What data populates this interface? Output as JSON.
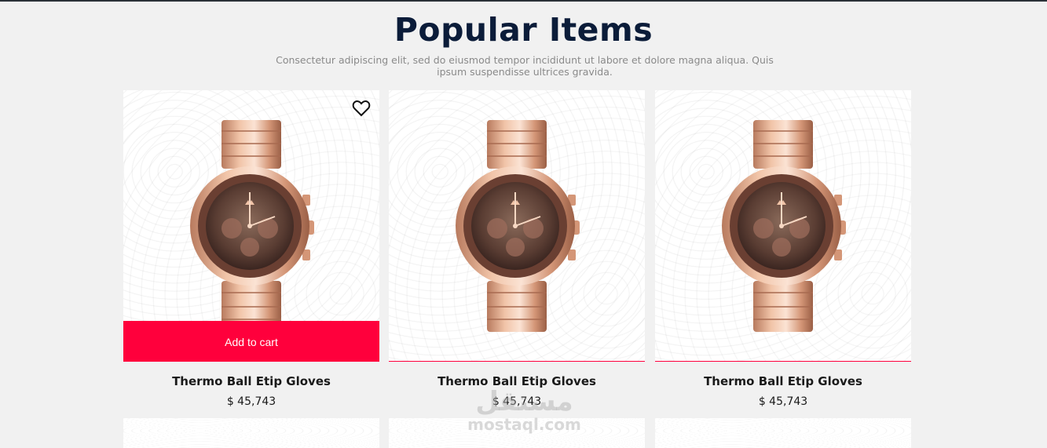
{
  "section": {
    "title": "Popular Items",
    "subtitle": "Consectetur adipiscing elit, sed do eiusmod tempor incididunt ut labore et dolore magna aliqua. Quis ipsum suspendisse ultrices gravida."
  },
  "products": [
    {
      "name": "Thermo Ball Etip Gloves",
      "price": "$ 45,743",
      "cta": "Add to cart",
      "icon": "heart-outline-icon"
    },
    {
      "name": "Thermo Ball Etip Gloves",
      "price": "$ 45,743"
    },
    {
      "name": "Thermo Ball Etip Gloves",
      "price": "$ 45,743"
    }
  ],
  "watermark": {
    "arabic": "مستقل",
    "latin": "mostaql.com"
  },
  "colors": {
    "accent": "#ff003c",
    "title": "#0b1c39",
    "background": "#f1f1f1"
  }
}
